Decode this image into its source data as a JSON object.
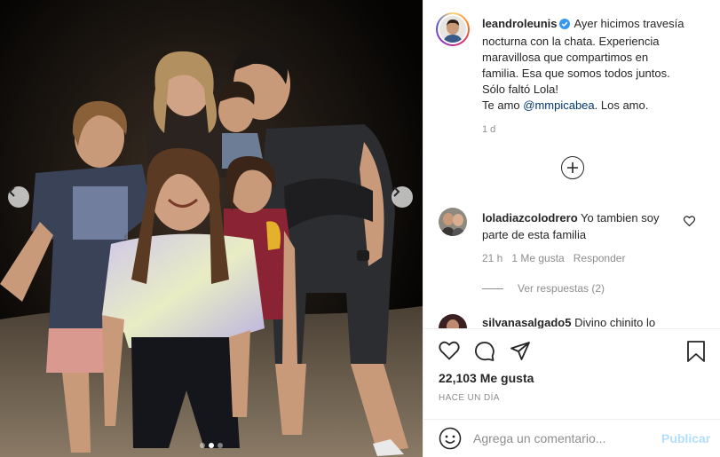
{
  "post": {
    "username": "leandroleunis",
    "verified_icon": "verified-badge-icon",
    "caption_lines": [
      "Ayer hicimos travesía",
      "nocturna con la chata. Experiencia",
      "maravillosa que compartimos en",
      "familia. Esa que somos todos juntos.",
      "Sólo faltó Lola!"
    ],
    "caption_last_prefix": "Te amo ",
    "caption_mention": "@mmpicabea",
    "caption_last_suffix": ". Los amo.",
    "time": "1 d"
  },
  "carousel": {
    "prev_icon": "chevron-left-icon",
    "next_icon": "chevron-right-icon",
    "slide_count": 3,
    "active_slide": 2
  },
  "load_more_icon": "plus-circle-icon",
  "comments": [
    {
      "username": "loladiazcolodrero",
      "text": "Yo tambien soy parte de esta familia",
      "time": "21 h",
      "likes": "1 Me gusta",
      "reply": "Responder",
      "view_replies": "Ver respuestas (2)"
    },
    {
      "username": "silvanasalgado5",
      "text": "Divino chinito lo"
    }
  ],
  "actions": {
    "like_icon": "heart-icon",
    "comment_icon": "comment-icon",
    "share_icon": "paper-plane-icon",
    "save_icon": "bookmark-icon"
  },
  "likes_count": "22,103 Me gusta",
  "post_date": "HACE UN DÍA",
  "comment_box": {
    "emoji_icon": "emoji-icon",
    "placeholder": "Agrega un comentario...",
    "publish_label": "Publicar"
  },
  "colors": {
    "link": "#00376b",
    "muted": "#8e8e8e",
    "publish_disabled": "#b2dffc"
  }
}
